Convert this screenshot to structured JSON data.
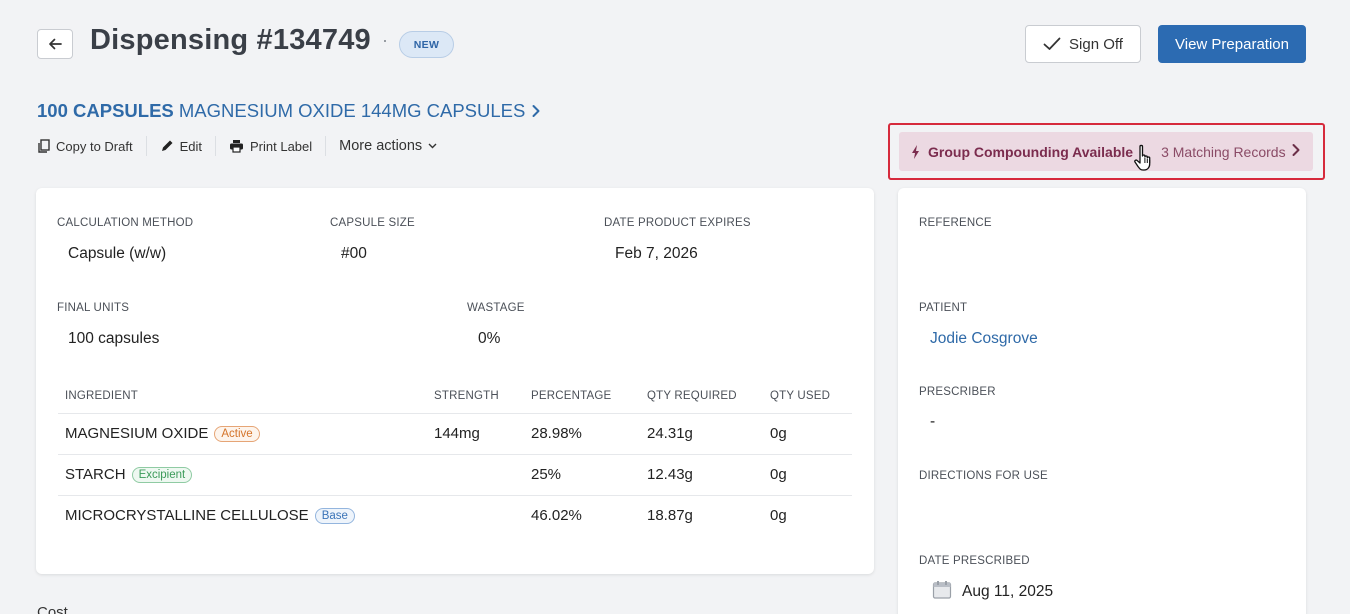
{
  "header": {
    "title": "Dispensing #134749",
    "separator": "·",
    "status_badge": "NEW",
    "sign_off_label": "Sign Off",
    "view_preparation_label": "View Preparation"
  },
  "product": {
    "quantity": "100 CAPSULES",
    "name": "MAGNESIUM OXIDE 144MG CAPSULES"
  },
  "actions": {
    "copy_to_draft": "Copy to Draft",
    "edit": "Edit",
    "print_label": "Print Label",
    "more_actions": "More actions"
  },
  "group_compounding": {
    "label": "Group Compounding Available",
    "matching": "3 Matching Records"
  },
  "details": {
    "calculation_method_label": "CALCULATION METHOD",
    "calculation_method": "Capsule (w/w)",
    "capsule_size_label": "CAPSULE SIZE",
    "capsule_size": "#00",
    "date_expires_label": "DATE PRODUCT EXPIRES",
    "date_expires": "Feb 7, 2026",
    "final_units_label": "FINAL UNITS",
    "final_units": "100 capsules",
    "wastage_label": "WASTAGE",
    "wastage": "0%"
  },
  "ingredients": {
    "headers": {
      "ingredient": "INGREDIENT",
      "strength": "STRENGTH",
      "percentage": "PERCENTAGE",
      "qty_required": "QTY REQUIRED",
      "qty_used": "QTY USED"
    },
    "rows": [
      {
        "name": "MAGNESIUM OXIDE",
        "tag": "Active",
        "strength": "144mg",
        "percentage": "28.98%",
        "qty_required": "24.31g",
        "qty_used": "0g"
      },
      {
        "name": "STARCH",
        "tag": "Excipient",
        "strength": "",
        "percentage": "25%",
        "qty_required": "12.43g",
        "qty_used": "0g"
      },
      {
        "name": "MICROCRYSTALLINE CELLULOSE",
        "tag": "Base",
        "strength": "",
        "percentage": "46.02%",
        "qty_required": "18.87g",
        "qty_used": "0g"
      }
    ]
  },
  "sidebar": {
    "reference_label": "REFERENCE",
    "reference": "",
    "patient_label": "PATIENT",
    "patient": "Jodie Cosgrove",
    "prescriber_label": "PRESCRIBER",
    "prescriber": "-",
    "directions_label": "DIRECTIONS FOR USE",
    "directions": "",
    "date_prescribed_label": "DATE PRESCRIBED",
    "date_prescribed": "Aug 11, 2025"
  },
  "footer": {
    "partial_text": "Cost"
  },
  "colors": {
    "primary": "#2c6bb2",
    "link": "#2f6aa8",
    "highlight_border": "#d62a3c",
    "group_bg": "#ecd9e2",
    "active_tag": "#d4742a",
    "excipient_tag": "#3c9b5a",
    "base_tag": "#3b74b8"
  }
}
